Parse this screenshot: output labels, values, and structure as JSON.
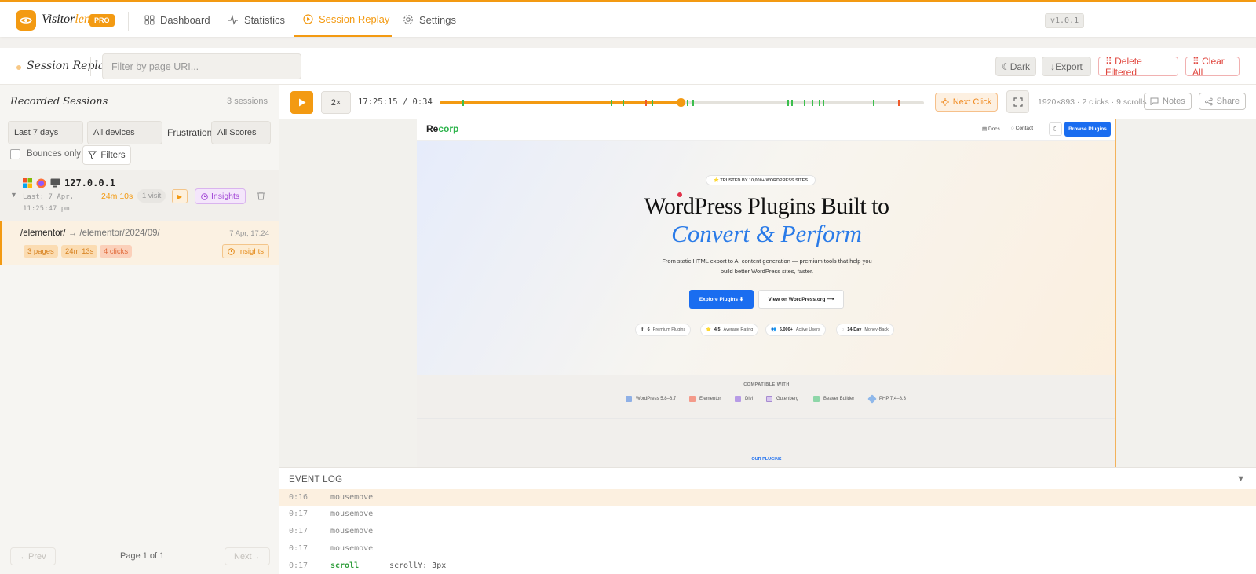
{
  "app": {
    "name_a": "Visitor",
    "name_b": "lens",
    "badge": "PRO",
    "version": "v1.0.1"
  },
  "nav": [
    {
      "label": "Dashboard",
      "icon": "grid-icon"
    },
    {
      "label": "Statistics",
      "icon": "pulse-icon"
    },
    {
      "label": "Session Replay",
      "icon": "play-circle-icon",
      "active": true
    },
    {
      "label": "Settings",
      "icon": "gear-icon"
    }
  ],
  "subbar": {
    "title": "Session Replay",
    "filter_placeholder": "Filter by page URI...",
    "dark_label": "☾Dark",
    "export_label": "↓Export",
    "delete_filtered_label": "⠿ Delete Filtered",
    "clear_all_label": "⠿ Clear All"
  },
  "sidebar": {
    "title": "Recorded Sessions",
    "count": "3 sessions",
    "filters": {
      "range": "Last 7 days",
      "devices": "All devices",
      "frustration_label": "Frustration",
      "scores": "All Scores",
      "bounces_label": "Bounces only",
      "filters_button": "Filters"
    },
    "session": {
      "ip": "127.0.0.1",
      "last_line1": "Last: 7 Apr,",
      "last_line2": "11:25:47 pm",
      "duration": "24m 10s",
      "visits": "1 visit",
      "play": "▶",
      "insights": "Insights",
      "collapse": "▼"
    },
    "page": {
      "from": "/elementor/",
      "arrow": "→",
      "to": "/elementor/2024/09/",
      "date": "7 Apr, 17:24",
      "pages": "3 pages",
      "duration": "24m 13s",
      "clicks": "4 clicks",
      "insights": "Insights"
    },
    "pager": {
      "prev": "←Prev",
      "page": "Page 1 of 1",
      "next": "Next→"
    }
  },
  "player": {
    "speed": "2×",
    "time": "17:25:15 / 0:34",
    "progress": 0.497,
    "next_click": "Next Click",
    "meta": "1920×893 · 2 clicks · 9 scrolls",
    "notes": "Notes",
    "share": "Share"
  },
  "site": {
    "logo_a": "Re",
    "logo_b": "corp",
    "nav_docs": "Docs",
    "nav_contact": "Contact",
    "nav_moon": "☾",
    "browse": "Browse Plugins",
    "trusted": "⭐ TRUSTED BY 10,000+ WORDPRESS SITES",
    "h1": "WordPress Plugins Built to",
    "h2": "Convert & Perform",
    "desc": "From static HTML export to AI content generation — premium tools that help you build better WordPress sites, faster.",
    "explore": "Explore Plugins ⬇",
    "view_wp": "View on WordPress.org ⟶",
    "stats": [
      {
        "icon": "⬆",
        "value": "6",
        "label": "Premium Plugins"
      },
      {
        "icon": "⭐",
        "value": "4.5",
        "label": "Average Rating"
      },
      {
        "icon": "👥",
        "value": "6,000+",
        "label": "Active Users"
      },
      {
        "icon": "◌",
        "value": "14-Day",
        "label": "Money-Back"
      }
    ],
    "compat_title": "COMPATIBLE WITH",
    "compat": [
      {
        "label": "WordPress 5.8–6.7",
        "color": "#8fb0e6"
      },
      {
        "label": "Elementor",
        "color": "#f49a8a"
      },
      {
        "label": "Divi",
        "color": "#b79be6"
      },
      {
        "label": "Gutenberg",
        "color": "#d8c7ef"
      },
      {
        "label": "Beaver Builder",
        "color": "#8ed6a8"
      },
      {
        "label": "PHP 7.4–8.3",
        "color": "#8fb8ea"
      }
    ],
    "our_plugins": "OUR PLUGINS"
  },
  "event_log": {
    "title": "EVENT LOG",
    "collapse": "▼",
    "rows": [
      {
        "t": "0:16",
        "e": "mousemove",
        "d": ""
      },
      {
        "t": "0:17",
        "e": "mousemove",
        "d": ""
      },
      {
        "t": "0:17",
        "e": "mousemove",
        "d": ""
      },
      {
        "t": "0:17",
        "e": "mousemove",
        "d": ""
      },
      {
        "t": "0:17",
        "e": "scroll",
        "d": "scrollY: 3px"
      }
    ]
  }
}
